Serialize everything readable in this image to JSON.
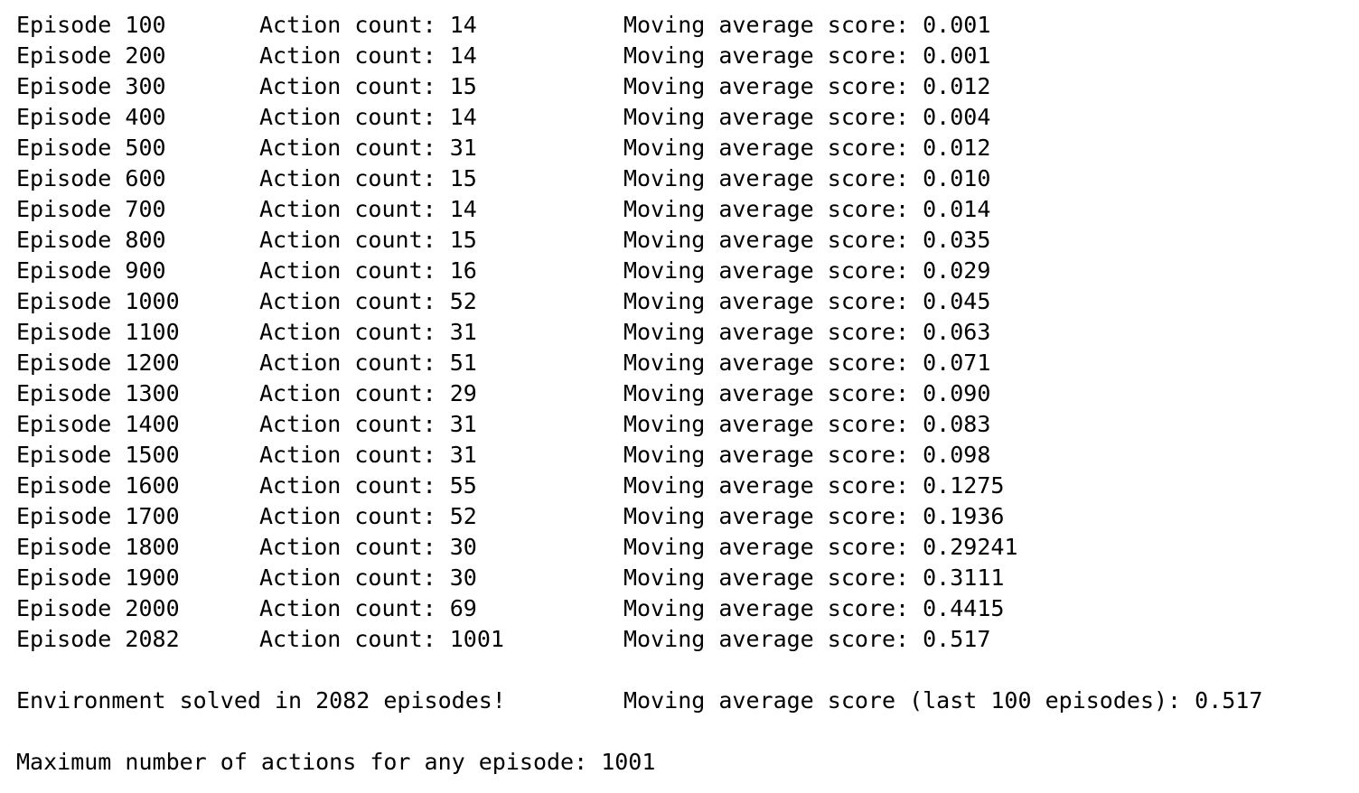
{
  "log": {
    "rows": [
      {
        "episode": "Episode 100",
        "action": "Action count: 14",
        "score": "Moving average score: 0.001"
      },
      {
        "episode": "Episode 200",
        "action": "Action count: 14",
        "score": "Moving average score: 0.001"
      },
      {
        "episode": "Episode 300",
        "action": "Action count: 15",
        "score": "Moving average score: 0.012"
      },
      {
        "episode": "Episode 400",
        "action": "Action count: 14",
        "score": "Moving average score: 0.004"
      },
      {
        "episode": "Episode 500",
        "action": "Action count: 31",
        "score": "Moving average score: 0.012"
      },
      {
        "episode": "Episode 600",
        "action": "Action count: 15",
        "score": "Moving average score: 0.010"
      },
      {
        "episode": "Episode 700",
        "action": "Action count: 14",
        "score": "Moving average score: 0.014"
      },
      {
        "episode": "Episode 800",
        "action": "Action count: 15",
        "score": "Moving average score: 0.035"
      },
      {
        "episode": "Episode 900",
        "action": "Action count: 16",
        "score": "Moving average score: 0.029"
      },
      {
        "episode": "Episode 1000",
        "action": "Action count: 52",
        "score": "Moving average score: 0.045"
      },
      {
        "episode": "Episode 1100",
        "action": "Action count: 31",
        "score": "Moving average score: 0.063"
      },
      {
        "episode": "Episode 1200",
        "action": "Action count: 51",
        "score": "Moving average score: 0.071"
      },
      {
        "episode": "Episode 1300",
        "action": "Action count: 29",
        "score": "Moving average score: 0.090"
      },
      {
        "episode": "Episode 1400",
        "action": "Action count: 31",
        "score": "Moving average score: 0.083"
      },
      {
        "episode": "Episode 1500",
        "action": "Action count: 31",
        "score": "Moving average score: 0.098"
      },
      {
        "episode": "Episode 1600",
        "action": "Action count: 55",
        "score": "Moving average score: 0.1275"
      },
      {
        "episode": "Episode 1700",
        "action": "Action count: 52",
        "score": "Moving average score: 0.1936"
      },
      {
        "episode": "Episode 1800",
        "action": "Action count: 30",
        "score": "Moving average score: 0.29241"
      },
      {
        "episode": "Episode 1900",
        "action": "Action count: 30",
        "score": "Moving average score: 0.3111"
      },
      {
        "episode": "Episode 2000",
        "action": "Action count: 69",
        "score": "Moving average score: 0.4415"
      },
      {
        "episode": "Episode 2082",
        "action": "Action count: 1001",
        "score": "Moving average score: 0.517"
      }
    ],
    "solved_message": "Environment solved in 2082 episodes!",
    "final_score_message": "Moving average score (last 100 episodes): 0.517",
    "max_actions_message": "Maximum number of actions for any episode: 1001"
  }
}
